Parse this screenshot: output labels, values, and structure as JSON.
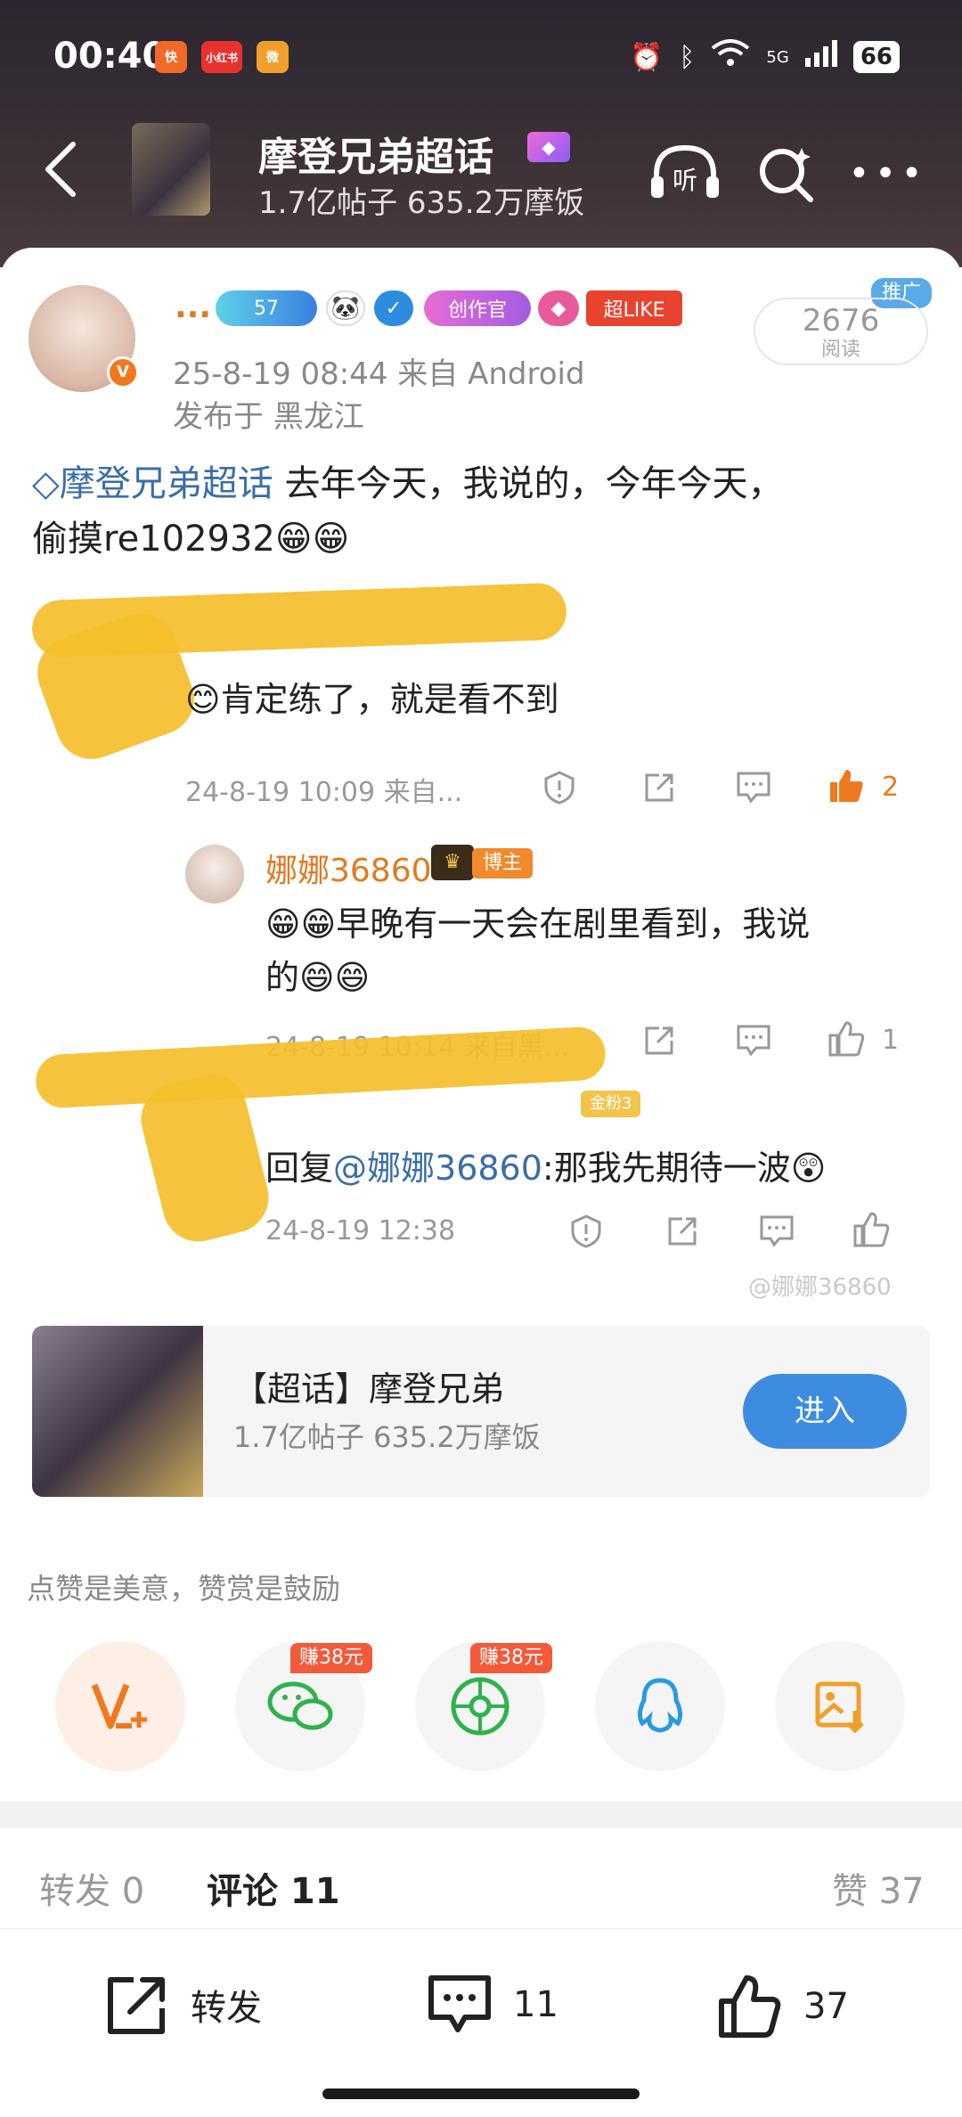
{
  "status_bar": {
    "time": "00:40",
    "app1": "快",
    "app2": "小红书",
    "app3": "微",
    "signal": "5G",
    "battery": "66"
  },
  "header": {
    "back_icon": "chevron-left-icon",
    "title": "摩登兄弟超话",
    "stats": "1.7亿帖子 635.2万摩饭",
    "listen_label": "听"
  },
  "post": {
    "username": "...",
    "level_badge": "57",
    "creator_badge": "创作官",
    "like_badge": "超LIKE",
    "promo_tag": "推广",
    "read_count": "2676",
    "read_label": "阅读",
    "meta": "25-8-19 08:44   来自 Android",
    "location": "发布于 黑龙江",
    "topic_link": "摩登兄弟超话",
    "body_line1": "  去年今天，我说的，今年今天，",
    "body_line2": "偷摸re102932😁😁"
  },
  "comments": [
    {
      "text": "😊肯定练了，就是看不到",
      "meta": "24-8-19 10:09  来自...",
      "likes": "2"
    },
    {
      "author": "娜娜36860",
      "role_tag": "博主",
      "text_line1": "😁😁早晚有一天会在剧里看到，我说",
      "text_line2": "的😄😄",
      "meta": "24-8-19 10:14  来自黑...",
      "likes": "1"
    },
    {
      "fan_tag": "金粉3",
      "reply_prefix": "回复",
      "reply_mention": "@娜娜36860",
      "reply_text": ":那我先期待一波😲",
      "meta": "24-8-19 12:38"
    }
  ],
  "watermark": "@娜娜36860",
  "topic_card": {
    "title": "【超话】摩登兄弟",
    "stats": "1.7亿帖子 635.2万摩饭",
    "enter_label": "进入"
  },
  "hint": "点赞是美意，赞赏是鼓励",
  "share_row": {
    "wechat_tag": "赚38元",
    "moments_tag": "赚38元"
  },
  "tabs": {
    "repost": "转发 0",
    "comments": "评论 11",
    "likes": "赞 37"
  },
  "toolbar": {
    "repost_label": "转发",
    "comment_count": "11",
    "like_count": "37"
  },
  "colors": {
    "accent_orange": "#f0781e",
    "link_blue": "#3a6da8",
    "enter_blue": "#3e8ce0"
  }
}
